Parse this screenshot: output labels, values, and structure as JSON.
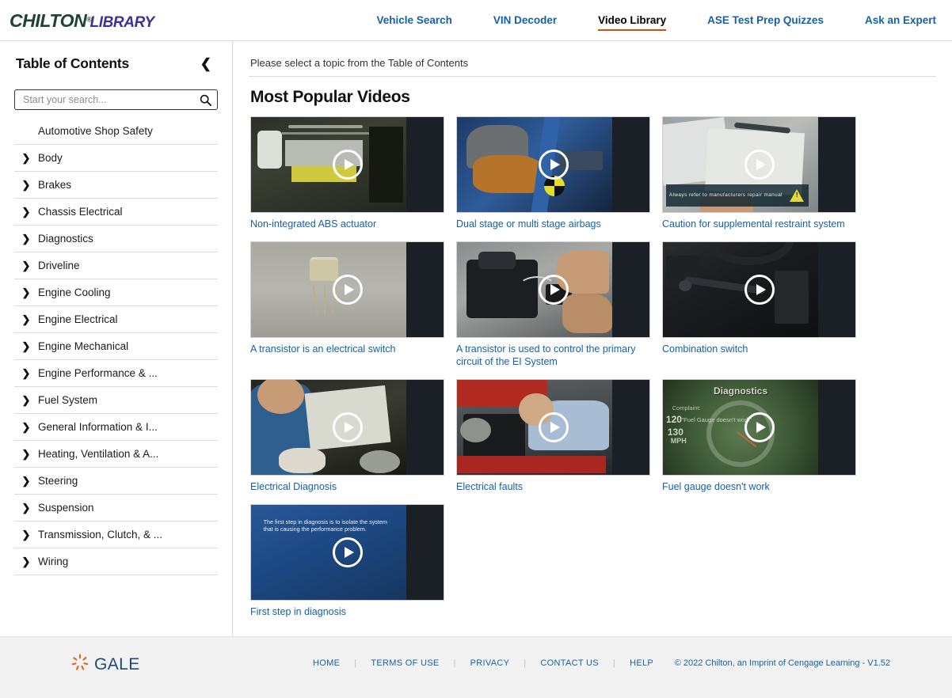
{
  "brand": {
    "name_primary": "CHILTON",
    "name_secondary": "LIBRARY",
    "registered_mark": "®",
    "primary_color": "#1f4232",
    "secondary_color": "#3b3296"
  },
  "nav": {
    "items": [
      {
        "label": "Vehicle Search",
        "active": false
      },
      {
        "label": "VIN Decoder",
        "active": false
      },
      {
        "label": "Video Library",
        "active": true
      },
      {
        "label": "ASE Test Prep Quizzes",
        "active": false
      },
      {
        "label": "Ask an Expert",
        "active": false
      }
    ],
    "link_color": "#1461a8",
    "active_underline_color": "#d2500d"
  },
  "sidebar": {
    "title": "Table of Contents",
    "collapse_icon": "chevron-left-icon",
    "search": {
      "placeholder": "Start your search...",
      "value": "",
      "icon": "search-icon"
    },
    "items": [
      {
        "label": "Automotive Shop Safety",
        "expandable": false
      },
      {
        "label": "Body",
        "expandable": true
      },
      {
        "label": "Brakes",
        "expandable": true
      },
      {
        "label": "Chassis Electrical",
        "expandable": true
      },
      {
        "label": "Diagnostics",
        "expandable": true
      },
      {
        "label": "Driveline",
        "expandable": true
      },
      {
        "label": "Engine Cooling",
        "expandable": true
      },
      {
        "label": "Engine Electrical",
        "expandable": true
      },
      {
        "label": "Engine Mechanical",
        "expandable": true
      },
      {
        "label": "Engine Performance & ...",
        "expandable": true
      },
      {
        "label": "Fuel System",
        "expandable": true
      },
      {
        "label": "General Information & I...",
        "expandable": true
      },
      {
        "label": "Heating, Ventilation & A...",
        "expandable": true
      },
      {
        "label": "Steering",
        "expandable": true
      },
      {
        "label": "Suspension",
        "expandable": true
      },
      {
        "label": "Transmission, Clutch, & ...",
        "expandable": true
      },
      {
        "label": "Wiring",
        "expandable": true
      }
    ]
  },
  "main": {
    "topic_note": "Please select a topic from the Table of Contents",
    "section_title": "Most Popular Videos",
    "videos": [
      {
        "caption": "Non-integrated ABS actuator",
        "art": "art-abs",
        "play_icon": "play-icon"
      },
      {
        "caption": "Dual stage or multi stage airbags",
        "art": "art-airbag",
        "play_icon": "play-icon"
      },
      {
        "caption": "Caution for supplemental restraint system",
        "art": "art-manual",
        "play_icon": "play-icon",
        "overlay_text": "Always refer to manufacturers repair manual"
      },
      {
        "caption": "A transistor is an electrical switch",
        "art": "art-trans",
        "play_icon": "play-icon"
      },
      {
        "caption": "A transistor is used to control the primary circuit of the EI System",
        "art": "art-coil",
        "play_icon": "play-icon"
      },
      {
        "caption": "Combination switch",
        "art": "art-switch",
        "play_icon": "play-icon"
      },
      {
        "caption": "Electrical Diagnosis",
        "art": "art-elecdiag",
        "play_icon": "play-icon"
      },
      {
        "caption": "Electrical faults",
        "art": "art-faults",
        "play_icon": "play-icon"
      },
      {
        "caption": "Fuel gauge doesn't work",
        "art": "art-gauge",
        "play_icon": "play-icon",
        "overlay_title": "Diagnostics",
        "overlay_complaint": "Complaint:",
        "overlay_quote": "\"Fuel Gauge doesn't work\"",
        "overlay_120": "120",
        "overlay_130": "130",
        "overlay_mph": "MPH"
      },
      {
        "caption": "First step in diagnosis",
        "art": "art-first",
        "play_icon": "play-icon",
        "overlay_text": "The first step in diagnosis is to isolate the system that is causing the performance problem."
      }
    ]
  },
  "footer": {
    "logo_text": "GALE",
    "logo_icon": "gale-pinwheel-icon",
    "logo_accent_color": "#e0601a",
    "logo_text_color": "#1b4a7a",
    "links": [
      "HOME",
      "TERMS OF USE",
      "PRIVACY",
      "CONTACT US",
      "HELP"
    ],
    "copyright": "© 2022 Chilton, an Imprint of Cengage Learning - V1.52"
  }
}
